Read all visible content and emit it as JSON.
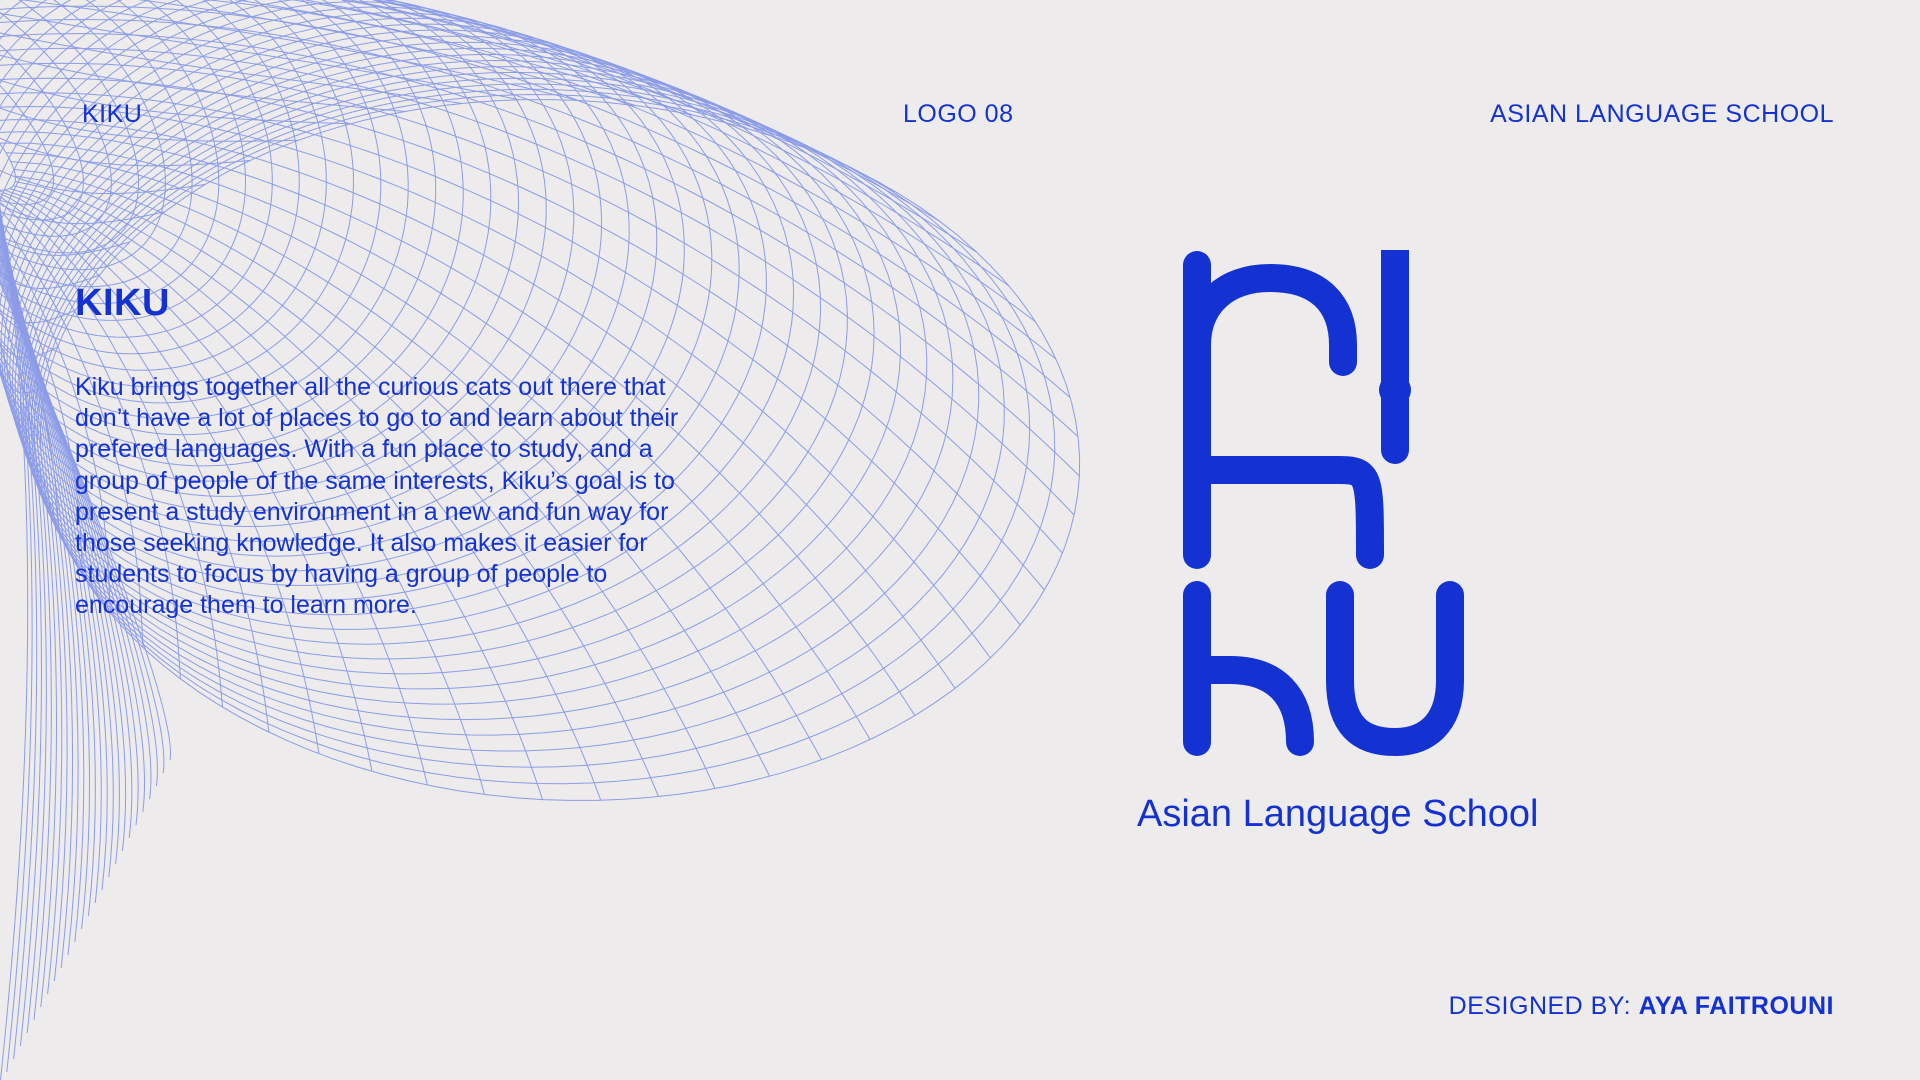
{
  "header": {
    "brand": "KIKU",
    "logo_number": "LOGO 08",
    "school": "ASIAN LANGUAGE SCHOOL"
  },
  "intro": {
    "title": "KIKU",
    "body": "Kiku brings together all the curious cats out there that don’t have a lot of places to go to and learn about their prefered languages. With a fun place to study, and a group of people of the same interests, Kiku’s goal is to present a study environment in a new and fun way for those seeking knowledge. It also makes it easier for students to focus by having a group of people to encourage them to learn more."
  },
  "logo": {
    "wordmark": "KIKU",
    "tagline": "Asian Language School"
  },
  "footer": {
    "credit_label": "DESIGNED BY:",
    "designer": "AYA FAITROUNI"
  },
  "colors": {
    "background": "#edebeb",
    "accent": "#1432d2",
    "mesh": "#8c9ce8"
  },
  "icons": {
    "background": "wire-mesh-graphic",
    "logo": "kiku-logo-mark"
  }
}
